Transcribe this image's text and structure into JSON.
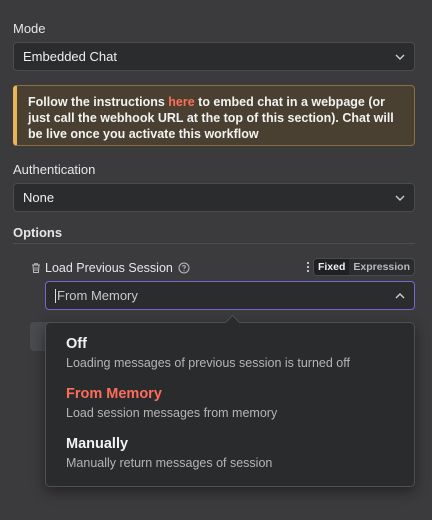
{
  "mode": {
    "label": "Mode",
    "value": "Embedded Chat"
  },
  "notice": {
    "before": "Follow the instructions ",
    "link": "here",
    "after": " to embed chat in a webpage (or just call the webhook URL at the top of this section). Chat will be live once you activate this workflow"
  },
  "auth": {
    "label": "Authentication",
    "value": "None"
  },
  "options": {
    "label": "Options",
    "param_label": "Load Previous Session",
    "toggle_fixed": "Fixed",
    "toggle_expression": "Expression",
    "value": "From Memory"
  },
  "dropdown": {
    "items": [
      {
        "title": "Off",
        "desc": "Loading messages of previous session is turned off"
      },
      {
        "title": "From Memory",
        "desc": "Load session messages from memory"
      },
      {
        "title": "Manually",
        "desc": "Manually return messages of session"
      }
    ]
  },
  "colors": {
    "accent": "#ff6d5a",
    "focus": "#7766cc",
    "notice_border": "#e9b45a"
  },
  "icons": [
    "chevron-down-icon",
    "chevron-up-icon",
    "trash-icon",
    "help-circle-icon",
    "vertical-dots-icon"
  ]
}
